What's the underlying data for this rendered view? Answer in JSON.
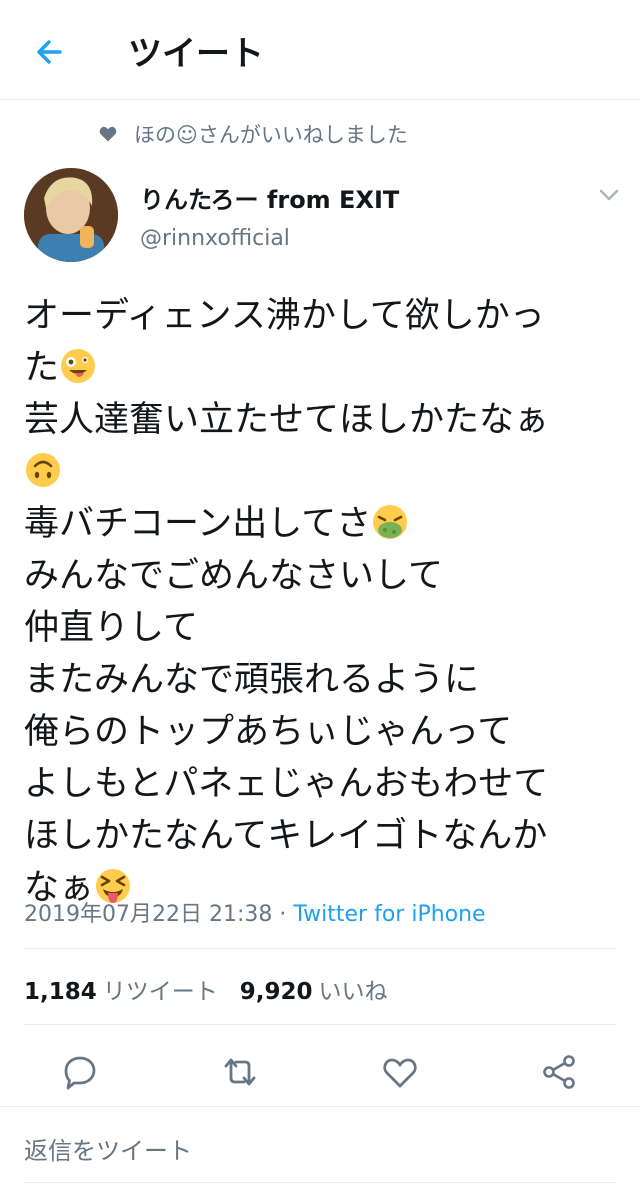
{
  "header": {
    "title": "ツイート"
  },
  "social_context": {
    "text": "ほの☺さんがいいねしました"
  },
  "author": {
    "display_name": "りんたろー from EXIT",
    "handle": "@rinnxofficial"
  },
  "tweet": {
    "lines": [
      "オーディェンス沸かして欲しかっ",
      "た",
      "芸人達奮い立たせてほしかたなぁ",
      "",
      "毒バチコーン出してさ",
      "みんなでごめんなさいして",
      "仲直りして",
      "またみんなで頑張れるように",
      "俺らのトップあちぃじゃんって",
      "よしもとパネェじゃんおもわせて",
      "ほしかたなんてキレイゴトなんか",
      "なぁ"
    ],
    "emojis": [
      "zany-face",
      "upside-down-face",
      "nauseated-face",
      "squinting-tongue-face"
    ]
  },
  "meta": {
    "timestamp": "2019年07月22日 21:38",
    "separator": " · ",
    "source": "Twitter for iPhone"
  },
  "stats": {
    "retweets_count": "1,184",
    "retweets_label": "リツイート",
    "likes_count": "9,920",
    "likes_label": "いいね"
  },
  "reply": {
    "placeholder": "返信をツイート"
  },
  "colors": {
    "accent": "#1da1f2",
    "muted": "#657786",
    "text": "#14171a",
    "divider": "#e6ecf0"
  }
}
